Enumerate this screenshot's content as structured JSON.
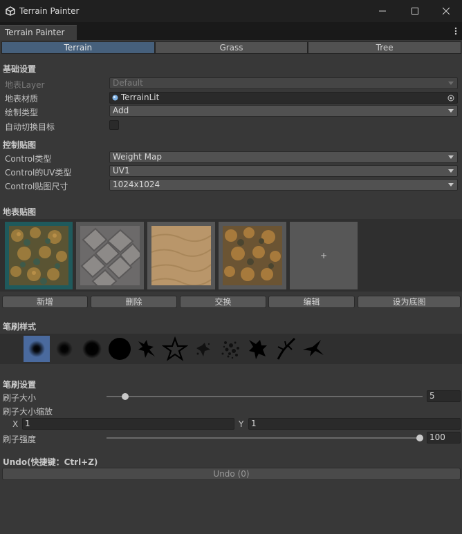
{
  "window": {
    "title": "Terrain Painter"
  },
  "tab": {
    "label": "Terrain Painter"
  },
  "modes": [
    {
      "label": "Terrain",
      "active": true
    },
    {
      "label": "Grass",
      "active": false
    },
    {
      "label": "Tree",
      "active": false
    }
  ],
  "basic": {
    "header": "基础设置",
    "layer_label": "地表Layer",
    "layer_value": "Default",
    "material_label": "地表材质",
    "material_value": "TerrainLit",
    "paint_type_label": "绘制类型",
    "paint_type_value": "Add",
    "auto_switch_label": "自动切换目标",
    "auto_switch_checked": false
  },
  "control": {
    "header": "控制贴图",
    "type_label": "Control类型",
    "type_value": "Weight Map",
    "uv_label": "Control的UV类型",
    "uv_value": "UV1",
    "size_label": "Control贴图尺寸",
    "size_value": "1024x1024"
  },
  "textures": {
    "header": "地表贴图",
    "items": [
      {
        "name": "forest-floor",
        "selected": true
      },
      {
        "name": "stone-tiles",
        "selected": false
      },
      {
        "name": "sand",
        "selected": false
      },
      {
        "name": "forest-floor-dry",
        "selected": false
      }
    ],
    "add_glyph": "+",
    "buttons": {
      "add": "新增",
      "delete": "删除",
      "swap": "交换",
      "edit": "编辑",
      "set_base": "设为底图"
    }
  },
  "brush_style": {
    "header": "笔刷样式",
    "selected_index": 0
  },
  "brush_settings": {
    "header": "笔刷设置",
    "size_label": "刷子大小",
    "size_value": 5,
    "size_fraction": 0.05,
    "scale_label": "刷子大小缩放",
    "scale_x_label": "X",
    "scale_x_value": "1",
    "scale_y_label": "Y",
    "scale_y_value": "1",
    "strength_label": "刷子强度",
    "strength_value": 100,
    "strength_fraction": 1.0
  },
  "undo": {
    "header": "Undo(快捷键：Ctrl+Z)",
    "button_label": "Undo (0)"
  },
  "colors": {
    "accent": "#46607c",
    "selected_tex": "#1f5a5c"
  }
}
